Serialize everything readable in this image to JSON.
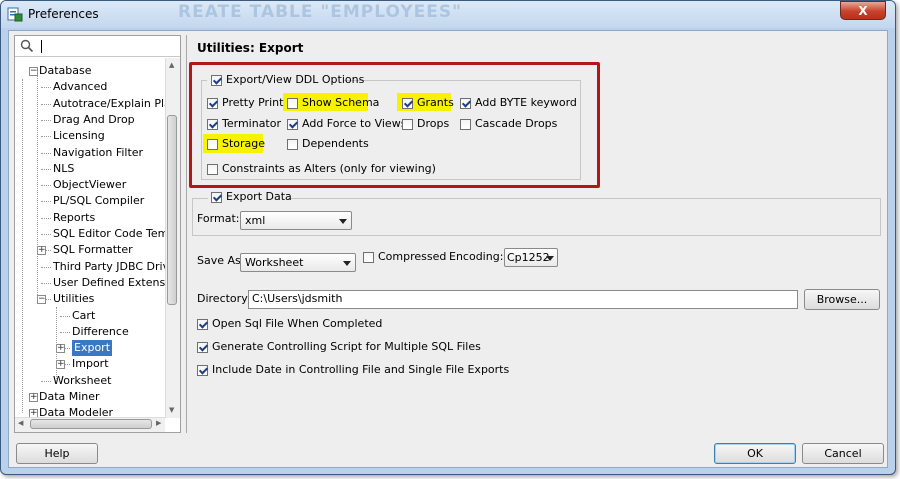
{
  "window": {
    "title": "Preferences",
    "ghost_text": "REATE TABLE \"EMPLOYEES\"",
    "close_glyph": "X"
  },
  "search": {
    "value": ""
  },
  "tree": {
    "items": [
      {
        "label": "Database",
        "level": 0,
        "expander": "-"
      },
      {
        "label": "Advanced",
        "level": 1
      },
      {
        "label": "Autotrace/Explain Plan",
        "level": 1
      },
      {
        "label": "Drag And Drop",
        "level": 1
      },
      {
        "label": "Licensing",
        "level": 1
      },
      {
        "label": "Navigation Filter",
        "level": 1
      },
      {
        "label": "NLS",
        "level": 1
      },
      {
        "label": "ObjectViewer",
        "level": 1
      },
      {
        "label": "PL/SQL Compiler",
        "level": 1
      },
      {
        "label": "Reports",
        "level": 1
      },
      {
        "label": "SQL Editor Code Templ",
        "level": 1
      },
      {
        "label": "SQL Formatter",
        "level": 1,
        "expander": "+"
      },
      {
        "label": "Third Party JDBC Drive",
        "level": 1
      },
      {
        "label": "User Defined Extension",
        "level": 1
      },
      {
        "label": "Utilities",
        "level": 1,
        "expander": "-"
      },
      {
        "label": "Cart",
        "level": 2
      },
      {
        "label": "Difference",
        "level": 2
      },
      {
        "label": "Export",
        "level": 2,
        "expander": "+",
        "selected": true
      },
      {
        "label": "Import",
        "level": 2,
        "expander": "+"
      },
      {
        "label": "Worksheet",
        "level": 1
      },
      {
        "label": "Data Miner",
        "level": 0,
        "expander": "+"
      },
      {
        "label": "Data Modeler",
        "level": 0,
        "expander": "+"
      }
    ]
  },
  "page": {
    "title": "Utilities: Export",
    "ddl_options": {
      "label": "Export/View DDL Options",
      "checked": true,
      "options": {
        "pretty_print": {
          "label": "Pretty Print",
          "checked": true
        },
        "show_schema": {
          "label": "Show Schema",
          "checked": false
        },
        "grants": {
          "label": "Grants",
          "checked": true
        },
        "add_byte": {
          "label": "Add BYTE keyword",
          "checked": true
        },
        "terminator": {
          "label": "Terminator",
          "checked": true
        },
        "add_force": {
          "label": "Add Force to Views",
          "checked": true
        },
        "drops": {
          "label": "Drops",
          "checked": false
        },
        "cascade_drops": {
          "label": "Cascade Drops",
          "checked": false
        },
        "storage": {
          "label": "Storage",
          "checked": false
        },
        "dependents": {
          "label": "Dependents",
          "checked": false
        },
        "constraints_alters": {
          "label": "Constraints as Alters (only for viewing)",
          "checked": false
        }
      }
    },
    "export_data": {
      "label": "Export Data",
      "checked": true
    },
    "format": {
      "label": "Format:",
      "value": "xml"
    },
    "save_as": {
      "label": "Save As",
      "value": "Worksheet"
    },
    "compressed": {
      "label": "Compressed",
      "checked": false
    },
    "encoding": {
      "label": "Encoding:",
      "value": "Cp1252"
    },
    "directory": {
      "label": "Directory:",
      "value": "C:\\Users\\jdsmith",
      "browse": "Browse..."
    },
    "open_sql": {
      "label": "Open Sql File When Completed",
      "checked": true
    },
    "gen_script": {
      "label": "Generate Controlling Script for Multiple SQL Files",
      "checked": true
    },
    "include_date": {
      "label": "Include Date in Controlling File and Single File Exports",
      "checked": true
    }
  },
  "footer": {
    "help": "Help",
    "ok": "OK",
    "cancel": "Cancel"
  },
  "colors": {
    "highlight": "#f6f200",
    "annotation_frame": "#b01818",
    "selection": "#3a78c3"
  }
}
